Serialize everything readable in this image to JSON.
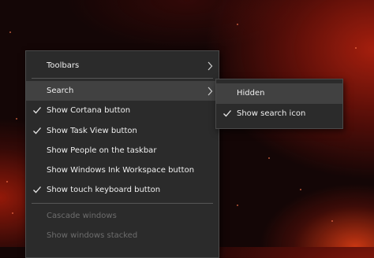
{
  "context_menu": {
    "items": [
      {
        "label": "Toolbars",
        "checked": false,
        "submenu": true,
        "disabled": false
      },
      {
        "label": "Search",
        "checked": false,
        "submenu": true,
        "disabled": false,
        "highlighted": true
      },
      {
        "label": "Show Cortana button",
        "checked": true,
        "submenu": false,
        "disabled": false
      },
      {
        "label": "Show Task View button",
        "checked": true,
        "submenu": false,
        "disabled": false
      },
      {
        "label": "Show People on the taskbar",
        "checked": false,
        "submenu": false,
        "disabled": false
      },
      {
        "label": "Show Windows Ink Workspace button",
        "checked": false,
        "submenu": false,
        "disabled": false
      },
      {
        "label": "Show touch keyboard button",
        "checked": true,
        "submenu": false,
        "disabled": false
      },
      {
        "label": "Cascade windows",
        "checked": false,
        "submenu": false,
        "disabled": true
      },
      {
        "label": "Show windows stacked",
        "checked": false,
        "submenu": false,
        "disabled": true
      }
    ]
  },
  "search_submenu": {
    "items": [
      {
        "label": "Hidden",
        "checked": false,
        "highlighted": true
      },
      {
        "label": "Show search icon",
        "checked": true,
        "highlighted": false
      }
    ]
  },
  "colors": {
    "menu_bg": "#2b2b2b",
    "hover_bg": "#414141",
    "text": "#f0f0f0",
    "disabled_text": "#6d6d6d"
  }
}
